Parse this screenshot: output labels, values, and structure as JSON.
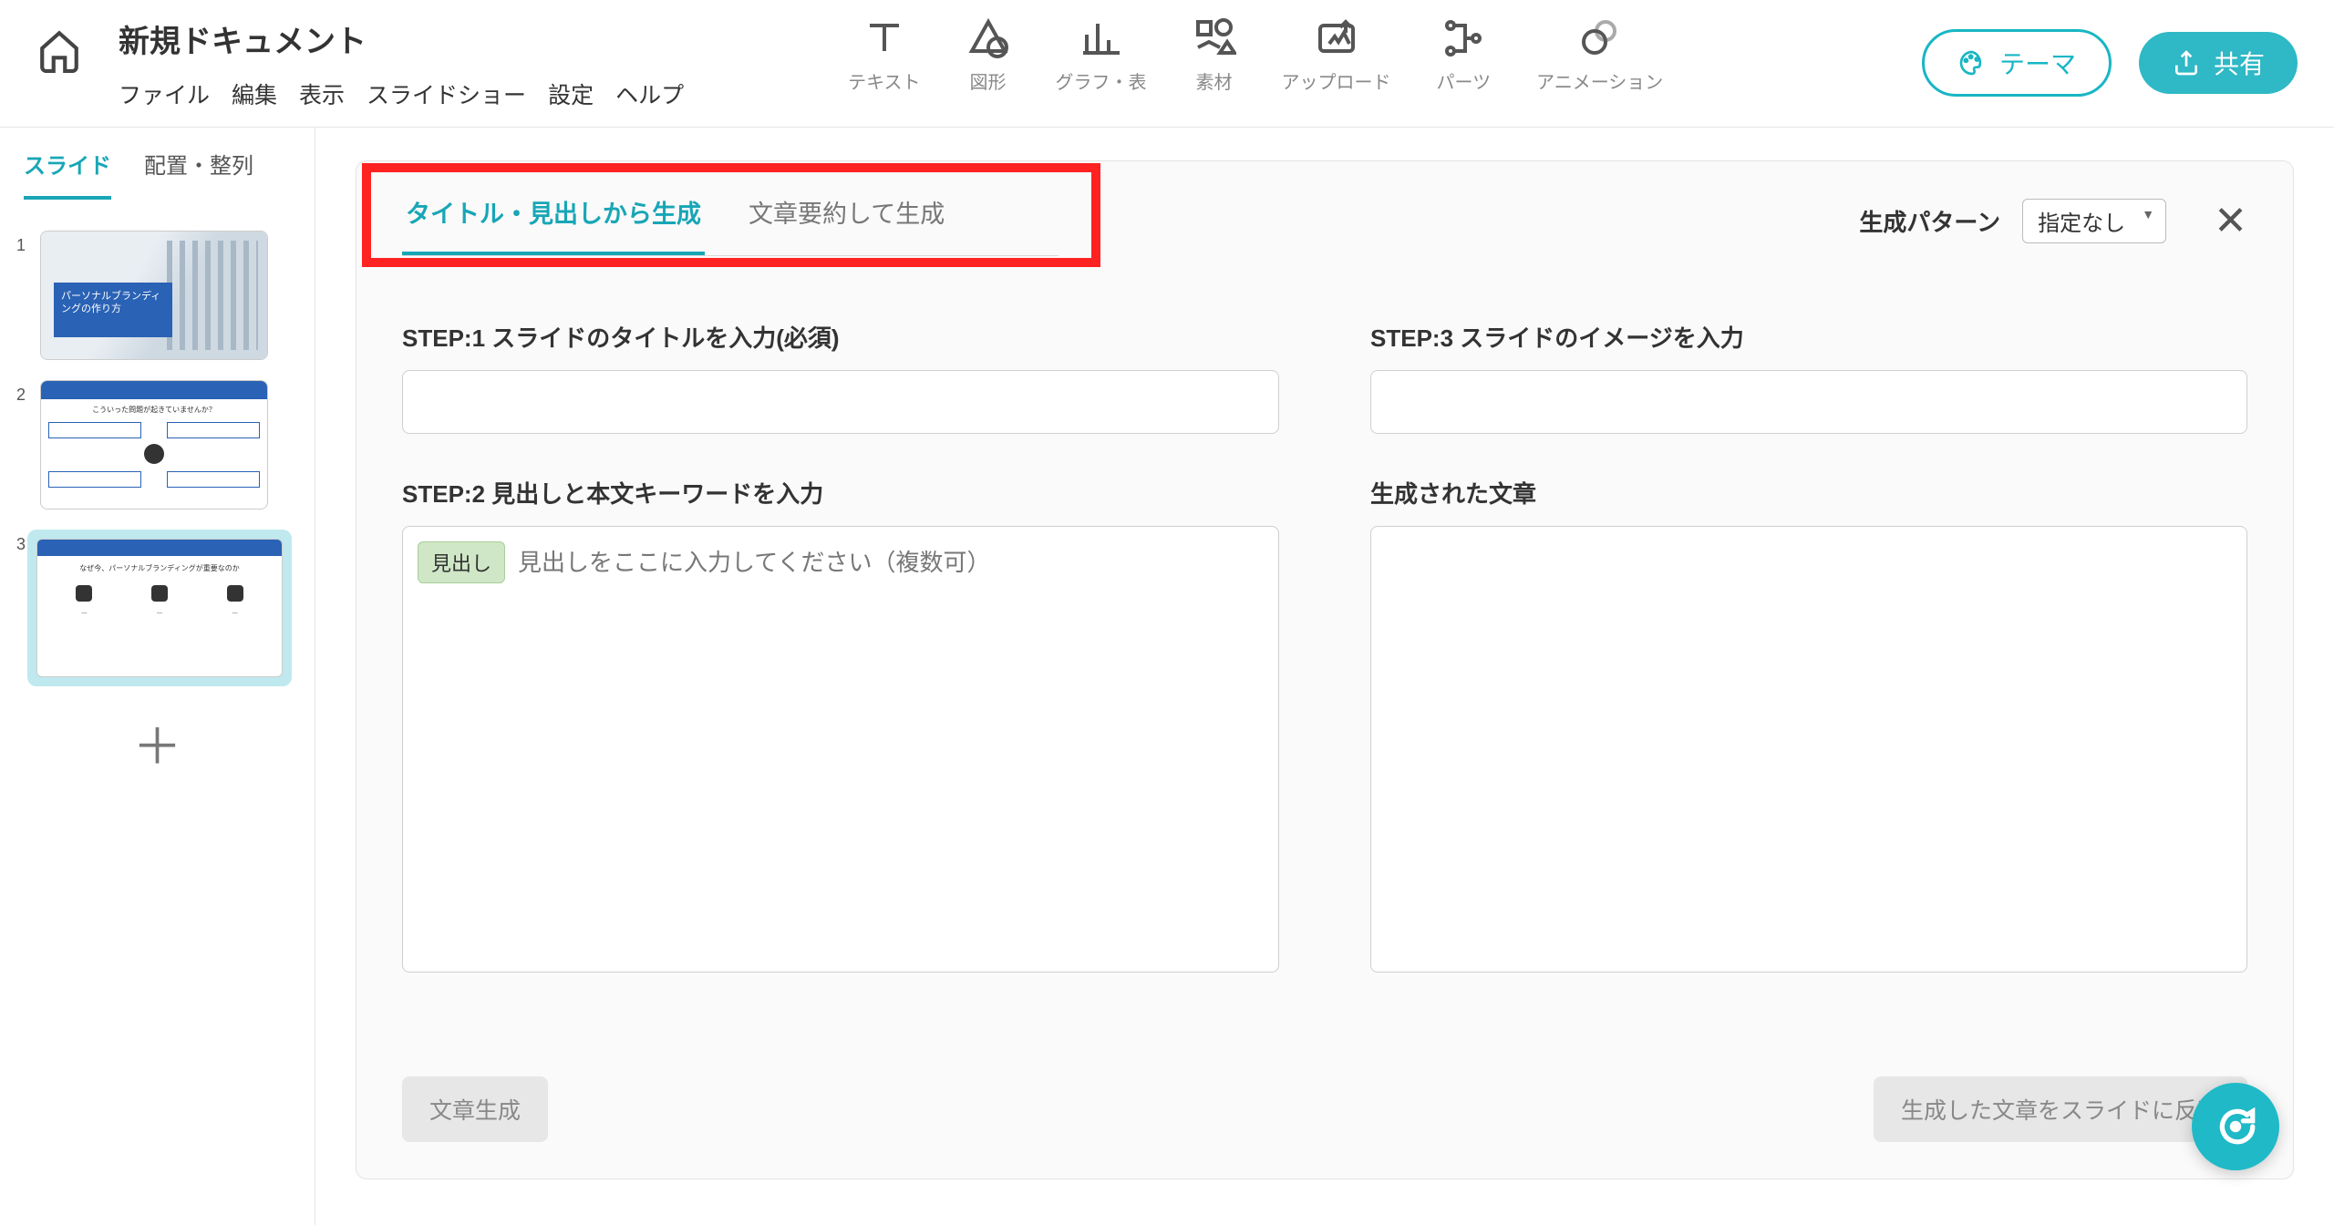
{
  "header": {
    "doc_title": "新規ドキュメント",
    "menu": [
      "ファイル",
      "編集",
      "表示",
      "スライドショー",
      "設定",
      "ヘルプ"
    ],
    "tools": [
      {
        "label": "テキスト",
        "icon": "text-icon"
      },
      {
        "label": "図形",
        "icon": "shape-icon"
      },
      {
        "label": "グラフ・表",
        "icon": "chart-icon"
      },
      {
        "label": "素材",
        "icon": "assets-icon"
      },
      {
        "label": "アップロード",
        "icon": "upload-icon"
      },
      {
        "label": "パーツ",
        "icon": "parts-icon"
      },
      {
        "label": "アニメーション",
        "icon": "animation-icon"
      }
    ],
    "theme_btn": "テーマ",
    "share_btn": "共有"
  },
  "sidebar": {
    "tabs": [
      "スライド",
      "配置・整列"
    ],
    "active_tab": 0,
    "slides": [
      {
        "num": "1",
        "caption": "パーソナルブランディングの作り方"
      },
      {
        "num": "2",
        "caption": "こういった問題が起きていませんか？"
      },
      {
        "num": "3",
        "caption": "なぜ今、パーソナルブランディングが重要なのか"
      }
    ],
    "selected": 2
  },
  "panel": {
    "tabs": [
      "タイトル・見出しから生成",
      "文章要約して生成"
    ],
    "active_tab": 0,
    "pattern_label": "生成パターン",
    "pattern_value": "指定なし",
    "step1_label": "STEP:1 スライドのタイトルを入力(必須)",
    "step1_value": "",
    "step2_label": "STEP:2 見出しと本文キーワードを入力",
    "step2_tag": "見出し",
    "step2_placeholder": "見出しをここに入力してください（複数可）",
    "step3_label": "STEP:3 スライドのイメージを入力",
    "step3_value": "",
    "generated_label": "生成された文章",
    "btn_generate": "文章生成",
    "btn_apply": "生成した文章をスライドに反映"
  }
}
